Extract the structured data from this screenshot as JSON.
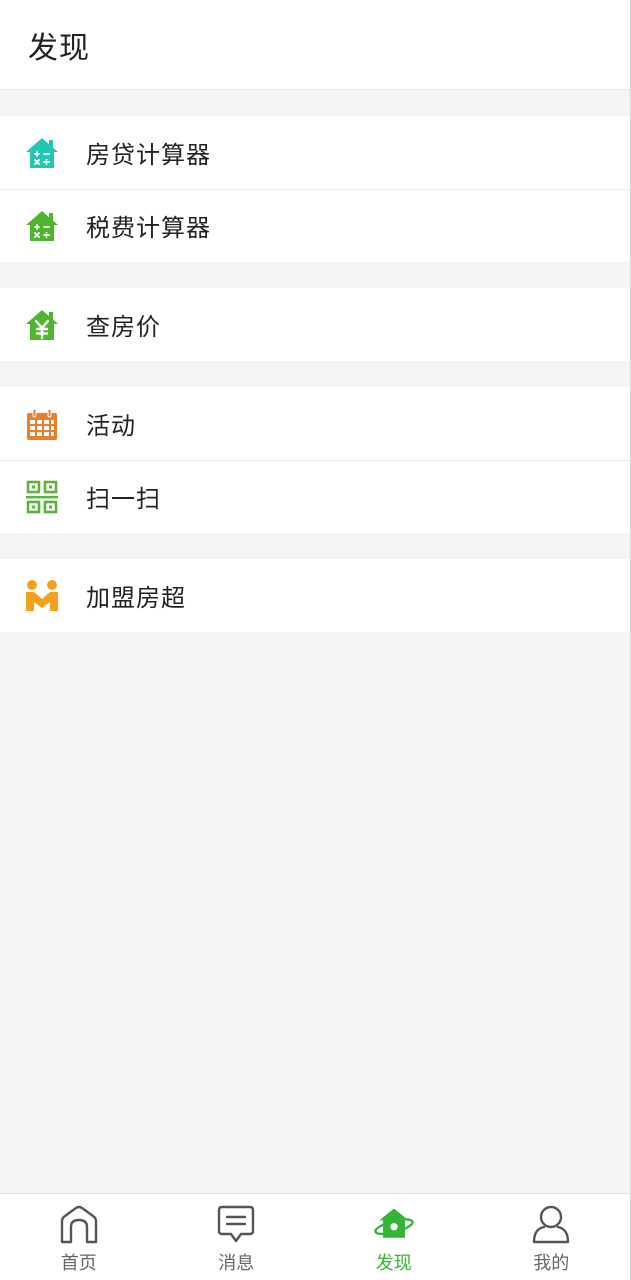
{
  "header": {
    "title": "发现"
  },
  "groups": [
    {
      "items": [
        {
          "label": "房贷计算器",
          "icon": "house-calculator-icon",
          "color": "#22c6b3"
        },
        {
          "label": "税费计算器",
          "icon": "house-calculator-icon",
          "color": "#4fb52f"
        }
      ]
    },
    {
      "items": [
        {
          "label": "查房价",
          "icon": "house-yuan-icon",
          "color": "#4fb52f"
        }
      ]
    },
    {
      "items": [
        {
          "label": "活动",
          "icon": "calendar-icon",
          "color": "#ec7d2a"
        },
        {
          "label": "扫一扫",
          "icon": "qr-code-icon",
          "color": "#5cb33b"
        }
      ]
    },
    {
      "items": [
        {
          "label": "加盟房超",
          "icon": "partners-icon",
          "color": "#f5a01c"
        }
      ]
    }
  ],
  "tabbar": {
    "active_color": "#35b535",
    "tabs": [
      {
        "label": "首页",
        "icon": "home-icon",
        "active": false
      },
      {
        "label": "消息",
        "icon": "message-icon",
        "active": false
      },
      {
        "label": "发现",
        "icon": "discover-icon",
        "active": true
      },
      {
        "label": "我的",
        "icon": "user-icon",
        "active": false
      }
    ]
  }
}
